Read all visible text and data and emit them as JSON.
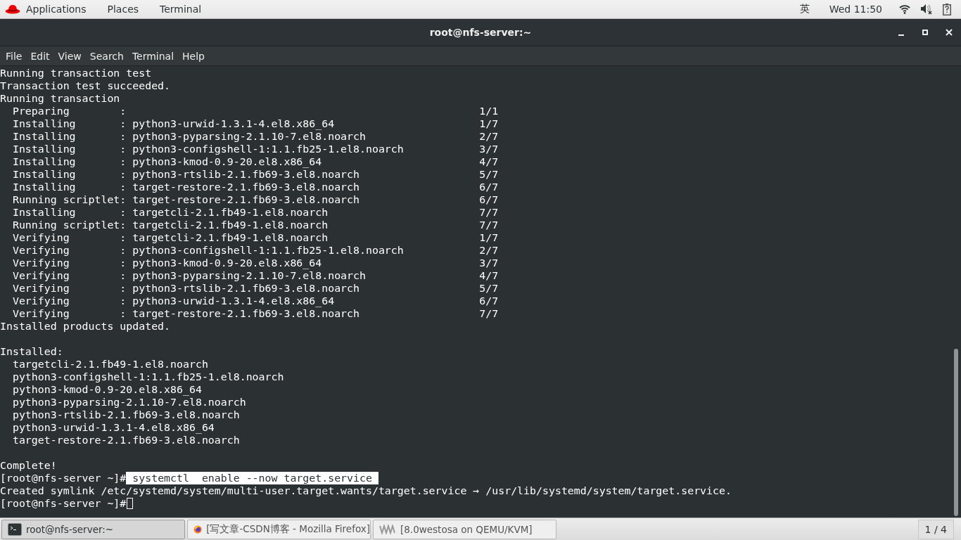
{
  "top_bar": {
    "menus": [
      "Applications",
      "Places",
      "Terminal"
    ],
    "input_method": "英",
    "clock": "Wed 11:50"
  },
  "window": {
    "title": "root@nfs-server:~"
  },
  "menu_bar": [
    "File",
    "Edit",
    "View",
    "Search",
    "Terminal",
    "Help"
  ],
  "terminal": {
    "lines": [
      {
        "kind": "text",
        "text": "Running transaction test"
      },
      {
        "kind": "text",
        "text": "Transaction test succeeded."
      },
      {
        "kind": "text",
        "text": "Running transaction"
      },
      {
        "kind": "text",
        "text": "  Preparing        :                                                        1/1"
      },
      {
        "kind": "text",
        "text": "  Installing       : python3-urwid-1.3.1-4.el8.x86_64                       1/7"
      },
      {
        "kind": "text",
        "text": "  Installing       : python3-pyparsing-2.1.10-7.el8.noarch                  2/7"
      },
      {
        "kind": "text",
        "text": "  Installing       : python3-configshell-1:1.1.fb25-1.el8.noarch            3/7"
      },
      {
        "kind": "text",
        "text": "  Installing       : python3-kmod-0.9-20.el8.x86_64                         4/7"
      },
      {
        "kind": "text",
        "text": "  Installing       : python3-rtslib-2.1.fb69-3.el8.noarch                   5/7"
      },
      {
        "kind": "text",
        "text": "  Installing       : target-restore-2.1.fb69-3.el8.noarch                   6/7"
      },
      {
        "kind": "text",
        "text": "  Running scriptlet: target-restore-2.1.fb69-3.el8.noarch                   6/7"
      },
      {
        "kind": "text",
        "text": "  Installing       : targetcli-2.1.fb49-1.el8.noarch                        7/7"
      },
      {
        "kind": "text",
        "text": "  Running scriptlet: targetcli-2.1.fb49-1.el8.noarch                        7/7"
      },
      {
        "kind": "text",
        "text": "  Verifying        : targetcli-2.1.fb49-1.el8.noarch                        1/7"
      },
      {
        "kind": "text",
        "text": "  Verifying        : python3-configshell-1:1.1.fb25-1.el8.noarch            2/7"
      },
      {
        "kind": "text",
        "text": "  Verifying        : python3-kmod-0.9-20.el8.x86_64                         3/7"
      },
      {
        "kind": "text",
        "text": "  Verifying        : python3-pyparsing-2.1.10-7.el8.noarch                  4/7"
      },
      {
        "kind": "text",
        "text": "  Verifying        : python3-rtslib-2.1.fb69-3.el8.noarch                   5/7"
      },
      {
        "kind": "text",
        "text": "  Verifying        : python3-urwid-1.3.1-4.el8.x86_64                       6/7"
      },
      {
        "kind": "text",
        "text": "  Verifying        : target-restore-2.1.fb69-3.el8.noarch                   7/7"
      },
      {
        "kind": "text",
        "text": "Installed products updated."
      },
      {
        "kind": "blank"
      },
      {
        "kind": "text",
        "text": "Installed:"
      },
      {
        "kind": "text",
        "text": "  targetcli-2.1.fb49-1.el8.noarch"
      },
      {
        "kind": "text",
        "text": "  python3-configshell-1:1.1.fb25-1.el8.noarch"
      },
      {
        "kind": "text",
        "text": "  python3-kmod-0.9-20.el8.x86_64"
      },
      {
        "kind": "text",
        "text": "  python3-pyparsing-2.1.10-7.el8.noarch"
      },
      {
        "kind": "text",
        "text": "  python3-rtslib-2.1.fb69-3.el8.noarch"
      },
      {
        "kind": "text",
        "text": "  python3-urwid-1.3.1-4.el8.x86_64"
      },
      {
        "kind": "text",
        "text": "  target-restore-2.1.fb69-3.el8.noarch"
      },
      {
        "kind": "blank"
      },
      {
        "kind": "text",
        "text": "Complete!"
      },
      {
        "kind": "prompt",
        "prompt": "[root@nfs-server ~]#",
        "command": " systemctl  enable --now target.service ",
        "selected": true
      },
      {
        "kind": "text",
        "text": "Created symlink /etc/systemd/system/multi-user.target.wants/target.service → /usr/lib/systemd/system/target.service."
      },
      {
        "kind": "prompt",
        "prompt": "[root@nfs-server ~]#",
        "cursor": true
      }
    ]
  },
  "taskbar": {
    "items": [
      {
        "kind": "terminal",
        "label": "root@nfs-server:~",
        "selected": true
      },
      {
        "kind": "browser",
        "label": "[写文章-CSDN博客 - Mozilla Firefox]",
        "selected": false
      },
      {
        "kind": "vm",
        "label": "[8.0westosa on QEMU/KVM]",
        "selected": false
      }
    ],
    "workspace": "1 / 4"
  }
}
